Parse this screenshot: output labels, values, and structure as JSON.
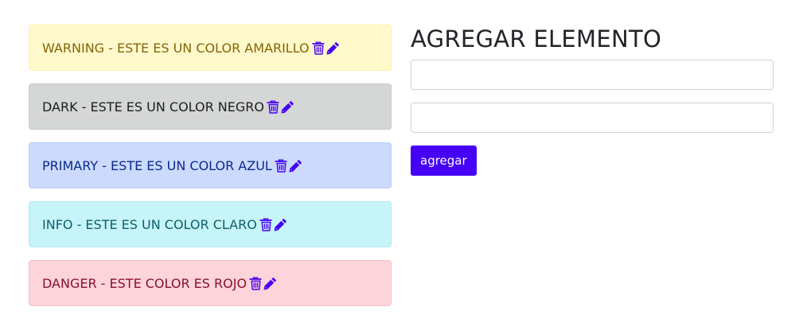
{
  "items": [
    {
      "text": "WARNING - ESTE ES UN COLOR AMARILLO",
      "variant": "warning",
      "icon_color": "#4500f5"
    },
    {
      "text": "DARK - ESTE ES UN COLOR NEGRO",
      "variant": "dark",
      "icon_color": "#4500f5"
    },
    {
      "text": "PRIMARY - ESTE ES UN COLOR AZUL",
      "variant": "primary",
      "icon_color": "#4500f5"
    },
    {
      "text": "INFO - ESTE ES UN COLOR CLARO",
      "variant": "info",
      "icon_color": "#4500f5"
    },
    {
      "text": "DANGER - ESTE COLOR ES ROJO",
      "variant": "danger",
      "icon_color": "#4500f5"
    }
  ],
  "icons": {
    "delete": "trash-icon",
    "edit": "pencil-icon"
  },
  "form": {
    "title": "AGREGAR ELEMENTO",
    "input1": {
      "value": "",
      "placeholder": ""
    },
    "input2": {
      "value": "",
      "placeholder": ""
    },
    "submit_label": "agregar"
  },
  "colors": {
    "accent": "#4500f5"
  }
}
